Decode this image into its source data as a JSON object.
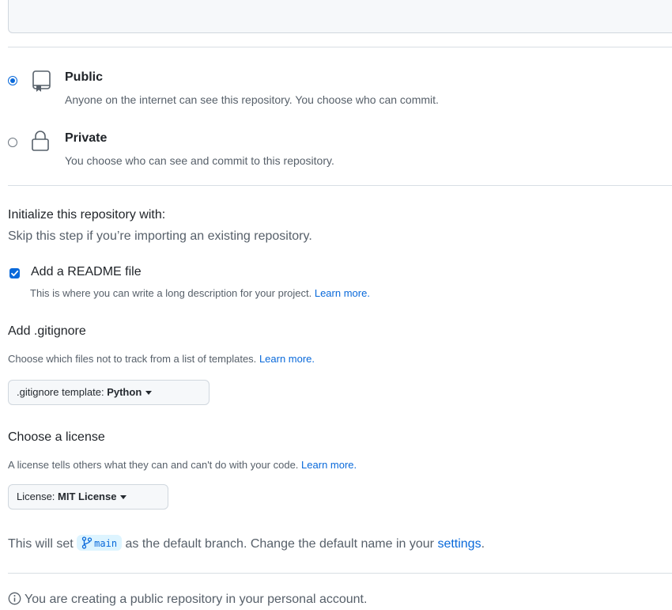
{
  "visibility": {
    "public": {
      "title": "Public",
      "description": "Anyone on the internet can see this repository. You choose who can commit.",
      "selected": true
    },
    "private": {
      "title": "Private",
      "description": "You choose who can see and commit to this repository.",
      "selected": false
    }
  },
  "initialize": {
    "heading": "Initialize this repository with:",
    "subheading": "Skip this step if you’re importing an existing repository.",
    "readme": {
      "label": "Add a README file",
      "checked": true,
      "description": "This is where you can write a long description for your project.",
      "link": "Learn more."
    }
  },
  "gitignore": {
    "heading": "Add .gitignore",
    "description": "Choose which files not to track from a list of templates.",
    "link": "Learn more.",
    "button_prefix": ".gitignore template:",
    "button_value": "Python"
  },
  "license": {
    "heading": "Choose a license",
    "description": "A license tells others what they can and can't do with your code.",
    "link": "Learn more.",
    "button_prefix": "License:",
    "button_value": "MIT License"
  },
  "branch": {
    "prefix": "This will set",
    "name": "main",
    "middle": "as the default branch. Change the default name in your",
    "link": "settings",
    "suffix": "."
  },
  "notice": {
    "text": "You are creating a public repository in your personal account."
  },
  "colors": {
    "accent": "#0969da",
    "muted_text": "#57606a",
    "border": "#d0d7de"
  }
}
